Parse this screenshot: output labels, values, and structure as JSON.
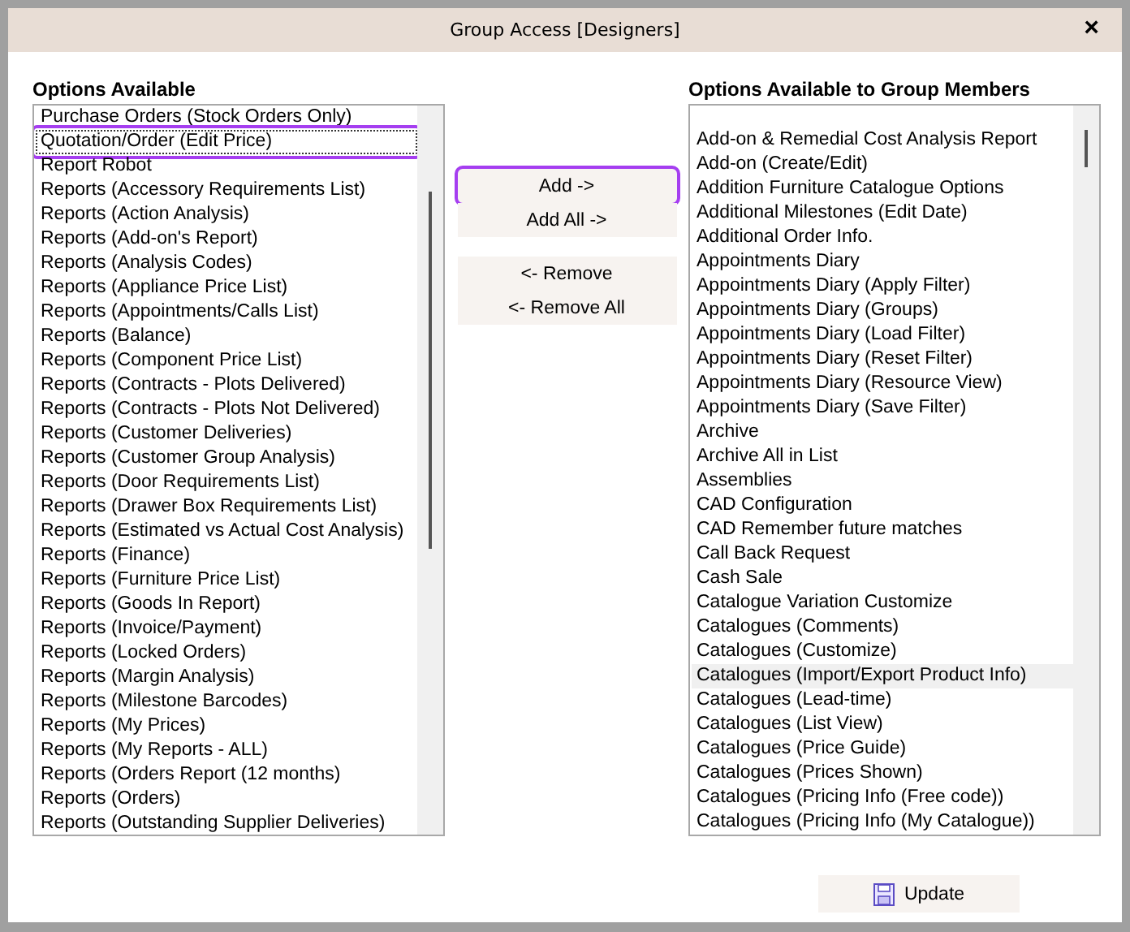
{
  "window": {
    "title": "Group Access [Designers]",
    "close": "×"
  },
  "available": {
    "heading": "Options Available",
    "items": [
      {
        "label": "Purchase Orders (Stock Orders Only)",
        "selected": false
      },
      {
        "label": "Quotation/Order (Edit Price)",
        "selected": true
      },
      {
        "label": "Report Robot",
        "selected": false
      },
      {
        "label": "Reports (Accessory Requirements List)",
        "selected": false
      },
      {
        "label": "Reports (Action Analysis)",
        "selected": false
      },
      {
        "label": "Reports (Add-on's Report)",
        "selected": false
      },
      {
        "label": "Reports (Analysis Codes)",
        "selected": false
      },
      {
        "label": "Reports (Appliance Price List)",
        "selected": false
      },
      {
        "label": "Reports (Appointments/Calls List)",
        "selected": false
      },
      {
        "label": "Reports (Balance)",
        "selected": false
      },
      {
        "label": "Reports (Component Price List)",
        "selected": false
      },
      {
        "label": "Reports (Contracts - Plots Delivered)",
        "selected": false
      },
      {
        "label": "Reports (Contracts - Plots Not Delivered)",
        "selected": false
      },
      {
        "label": "Reports (Customer Deliveries)",
        "selected": false
      },
      {
        "label": "Reports (Customer Group Analysis)",
        "selected": false
      },
      {
        "label": "Reports (Door Requirements List)",
        "selected": false
      },
      {
        "label": "Reports (Drawer Box Requirements List)",
        "selected": false
      },
      {
        "label": "Reports (Estimated vs Actual Cost Analysis)",
        "selected": false
      },
      {
        "label": "Reports (Finance)",
        "selected": false
      },
      {
        "label": "Reports (Furniture Price List)",
        "selected": false
      },
      {
        "label": "Reports (Goods In Report)",
        "selected": false
      },
      {
        "label": "Reports (Invoice/Payment)",
        "selected": false
      },
      {
        "label": "Reports (Locked Orders)",
        "selected": false
      },
      {
        "label": "Reports (Margin Analysis)",
        "selected": false
      },
      {
        "label": "Reports (Milestone Barcodes)",
        "selected": false
      },
      {
        "label": "Reports (My Prices)",
        "selected": false
      },
      {
        "label": "Reports (My Reports - ALL)",
        "selected": false
      },
      {
        "label": "Reports (Orders Report (12 months)",
        "selected": false
      },
      {
        "label": "Reports (Orders)",
        "selected": false
      },
      {
        "label": "Reports (Outstanding Supplier Deliveries)",
        "selected": false
      }
    ]
  },
  "buttons": [
    {
      "label": "Add ->",
      "highlighted": true
    },
    {
      "label": "Add All ->",
      "highlighted": false
    },
    {
      "label": "<- Remove",
      "highlighted": false
    },
    {
      "label": "<- Remove All",
      "highlighted": false
    }
  ],
  "members": {
    "heading": "Options Available to Group Members",
    "items": [
      {
        "label": "Add-on & Remedial Cost Analysis Report",
        "selected": false
      },
      {
        "label": "Add-on (Create/Edit)",
        "selected": false
      },
      {
        "label": "Addition Furniture Catalogue Options",
        "selected": false
      },
      {
        "label": "Additional Milestones (Edit Date)",
        "selected": false
      },
      {
        "label": "Additional Order Info.",
        "selected": false
      },
      {
        "label": "Appointments Diary",
        "selected": false
      },
      {
        "label": "Appointments Diary (Apply Filter)",
        "selected": false
      },
      {
        "label": "Appointments Diary (Groups)",
        "selected": false
      },
      {
        "label": "Appointments Diary (Load Filter)",
        "selected": false
      },
      {
        "label": "Appointments Diary (Reset Filter)",
        "selected": false
      },
      {
        "label": "Appointments Diary (Resource View)",
        "selected": false
      },
      {
        "label": "Appointments Diary (Save Filter)",
        "selected": false
      },
      {
        "label": "Archive",
        "selected": false
      },
      {
        "label": "Archive All in List",
        "selected": false
      },
      {
        "label": "Assemblies",
        "selected": false
      },
      {
        "label": "CAD Configuration",
        "selected": false
      },
      {
        "label": "CAD Remember future matches",
        "selected": false
      },
      {
        "label": "Call Back Request",
        "selected": false
      },
      {
        "label": "Cash Sale",
        "selected": false
      },
      {
        "label": "Catalogue Variation Customize",
        "selected": false
      },
      {
        "label": "Catalogues (Comments)",
        "selected": false
      },
      {
        "label": "Catalogues (Customize)",
        "selected": false
      },
      {
        "label": "Catalogues (Import/Export Product Info)",
        "selected": true
      },
      {
        "label": "Catalogues (Lead-time)",
        "selected": false
      },
      {
        "label": "Catalogues (List View)",
        "selected": false
      },
      {
        "label": "Catalogues (Price Guide)",
        "selected": false
      },
      {
        "label": "Catalogues (Prices Shown)",
        "selected": false
      },
      {
        "label": "Catalogues (Pricing Info (Free code))",
        "selected": false
      },
      {
        "label": "Catalogues (Pricing Info (My Catalogue))",
        "selected": false
      }
    ]
  },
  "update_button": {
    "label": "Update"
  }
}
